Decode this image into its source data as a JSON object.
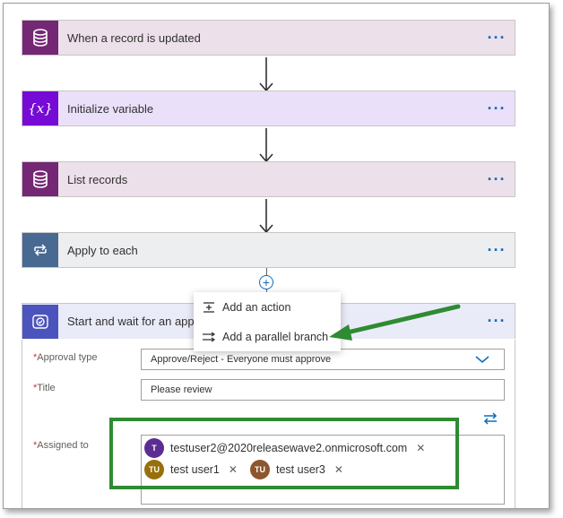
{
  "steps": [
    {
      "title": "When a record is updated",
      "icon": "database-icon",
      "color": "#742774",
      "bg": "#ece0ea"
    },
    {
      "title": "Initialize variable",
      "icon": "variable-icon",
      "color": "#770bd6",
      "bg": "#eae0f9"
    },
    {
      "title": "List records",
      "icon": "database-icon",
      "color": "#742774",
      "bg": "#ece0ea"
    },
    {
      "title": "Apply to each",
      "icon": "loop-icon",
      "color": "#486991",
      "bg": "#edeef0"
    },
    {
      "title": "Start and wait for an appro",
      "icon": "approval-icon",
      "color": "#4b53bc",
      "bg": "#eaebf8"
    }
  ],
  "more_label": "···",
  "add_button_label": "+",
  "context_menu": {
    "items": [
      {
        "label": "Add an action",
        "icon": "add-action-icon"
      },
      {
        "label": "Add a parallel branch",
        "icon": "parallel-branch-icon"
      }
    ]
  },
  "approval_form": {
    "approval_type_label": "Approval type",
    "approval_type_value": "Approve/Reject - Everyone must approve",
    "title_label": "Title",
    "title_value": "Please review",
    "assigned_to_label": "Assigned to",
    "required_marker": "*",
    "assignees": [
      {
        "initials": "T",
        "name": "testuser2@2020releasewave2.onmicrosoft.com",
        "avatar_color": "#5c2d91"
      },
      {
        "initials": "TU",
        "name": "test user1",
        "avatar_color": "#986f0b"
      },
      {
        "initials": "TU",
        "name": "test user3",
        "avatar_color": "#8e562e"
      }
    ]
  },
  "annotation_color": "#2e8b32"
}
